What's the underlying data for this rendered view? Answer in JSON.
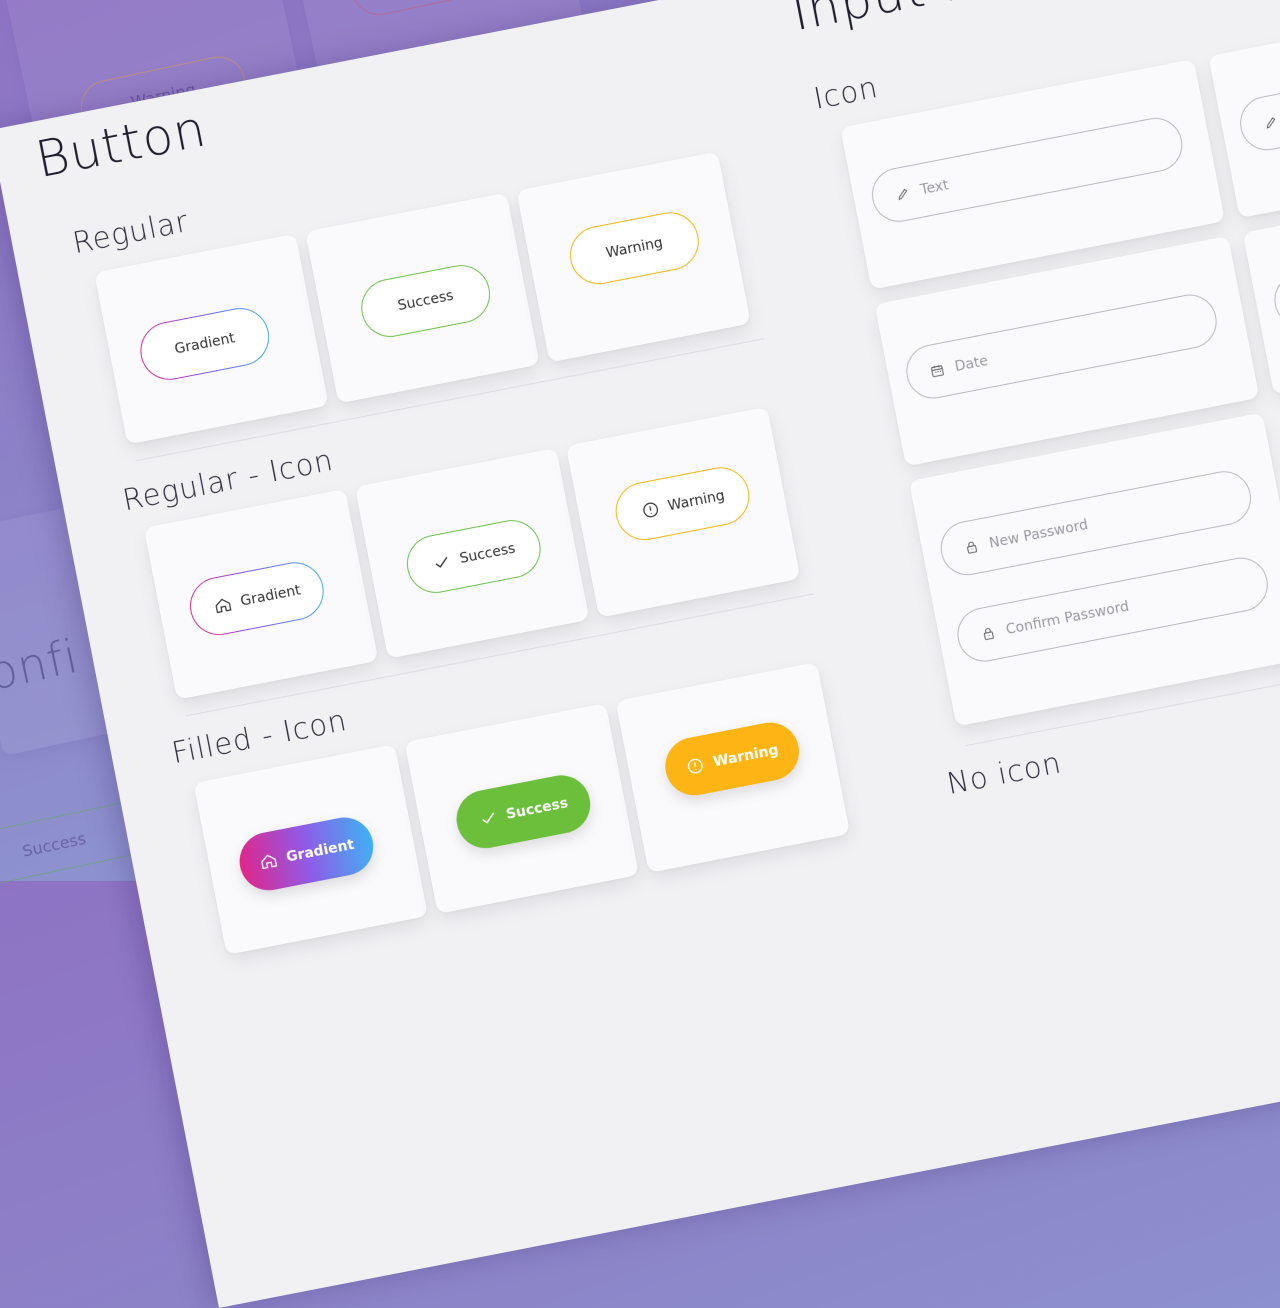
{
  "background": {
    "warning_button": "Warning",
    "partial_button": "D",
    "success_button": "Success",
    "confirm_heading": "Confi",
    "side_label": "s"
  },
  "button_section": {
    "title": "Button",
    "regular": {
      "heading": "Regular",
      "buttons": [
        "Gradient",
        "Success",
        "Warning"
      ]
    },
    "regular_icon": {
      "heading": "Regular - Icon",
      "buttons": [
        "Gradient",
        "Success",
        "Warning"
      ]
    },
    "filled_icon": {
      "heading": "Filled - Icon",
      "buttons": [
        "Gradient",
        "Success",
        "Warning"
      ]
    }
  },
  "input_section": {
    "title": "Input Field & TextF",
    "icon_heading": "Icon",
    "fields": {
      "text": "Text",
      "date": "Date",
      "new_password": "New Password",
      "confirm_password": "Confirm Password"
    },
    "no_icon_heading": "No icon"
  },
  "colors": {
    "success": "#6bbf3a",
    "warning": "#fdb515",
    "gradient_start": "#e0268a",
    "gradient_end": "#3fb1f5"
  },
  "icons": [
    "home-icon",
    "check-icon",
    "alert-circle-icon",
    "pencil-icon",
    "calendar-icon",
    "lock-icon"
  ]
}
